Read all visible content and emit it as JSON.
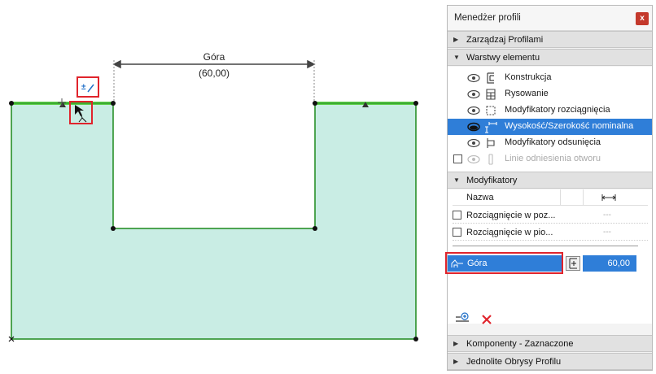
{
  "canvas": {
    "dimension_label": "Góra",
    "dimension_value": "(60,00)"
  },
  "panel": {
    "title": "Menedżer profili",
    "close_label": "x",
    "sections": {
      "manage": "Zarządzaj Profilami",
      "layers": "Warstwy elementu",
      "modifiers": "Modyfikatory",
      "components": "Komponenty - Zaznaczone",
      "outlines": "Jednolite Obrysy Profilu"
    },
    "layers": [
      {
        "label": "Konstrukcja",
        "icon": "construction-icon"
      },
      {
        "label": "Rysowanie",
        "icon": "drawing-icon"
      },
      {
        "label": "Modyfikatory rozciągnięcia",
        "icon": "stretch-modifier-icon"
      },
      {
        "label": "Wysokość/Szerokość nominalna",
        "icon": "nominal-size-icon",
        "selected": true
      },
      {
        "label": "Modyfikatory odsunięcia",
        "icon": "offset-modifier-icon"
      },
      {
        "label": "Linie odniesienia otworu",
        "icon": "opening-reference-icon",
        "disabled": true
      }
    ],
    "modifiers_table": {
      "col_name": "Nazwa",
      "rows": [
        {
          "name": "Rozciągnięcie w poz...",
          "value": "---"
        },
        {
          "name": "Rozciągnięcie w pio...",
          "value": "---"
        }
      ],
      "selected": {
        "name": "Góra",
        "value": "60,00"
      }
    }
  },
  "colors": {
    "accent": "#2f7ed8",
    "profile_fill": "#c9ede4",
    "profile_edge": "#1d8a1d",
    "highlight_edge": "#5fcf4a",
    "annotation": "#e0242c"
  }
}
